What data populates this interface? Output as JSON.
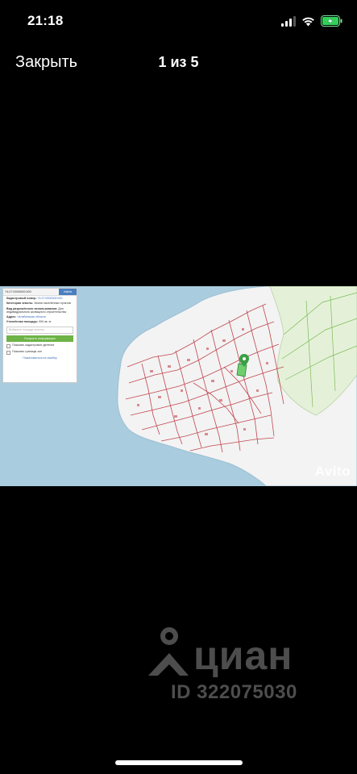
{
  "status_bar": {
    "time": "21:18",
    "icons": [
      "cellular-signal-icon",
      "wifi-icon",
      "battery-charging-icon"
    ],
    "battery_color": "#30d158"
  },
  "header": {
    "close_label": "Закрыть",
    "counter": "1 из 5"
  },
  "photo": {
    "panel": {
      "search_value": "74:27:0000000:000",
      "search_button": "Найти",
      "cadastral_label": "Кадастровый номер:",
      "cadastral_value": "74:27:0000000:000",
      "category_label": "Категория земель:",
      "category_value": "Земли населённых пунктов",
      "use_label": "Вид разрешённого использования:",
      "use_value": "Для индивидуального жилищного строительства",
      "address_label": "Адрес:",
      "address_value": "Челябинская область",
      "area_label": "Уточнённая площадь:",
      "area_value": "000 кв. м",
      "input_placeholder": "Выберите площадь участка",
      "green_button": "Получить информацию",
      "checkbox_1": "Показать кадастровое деление",
      "checkbox_2": "Показать границы зон",
      "footer_link": "Пожаловаться на ошибку"
    },
    "watermark": "Avito"
  },
  "cian_watermark": {
    "brand": "циан",
    "id_text": "ID 322075030",
    "color": "#4d4d4d"
  },
  "colors": {
    "background": "#000000",
    "water": "#a9ccdf",
    "land": "#f3f3f3",
    "parcel_border": "#c0474f",
    "green_area": "#e4f1d8",
    "selected_parcel": "#6fcf6f",
    "marker": "#3aa046"
  }
}
